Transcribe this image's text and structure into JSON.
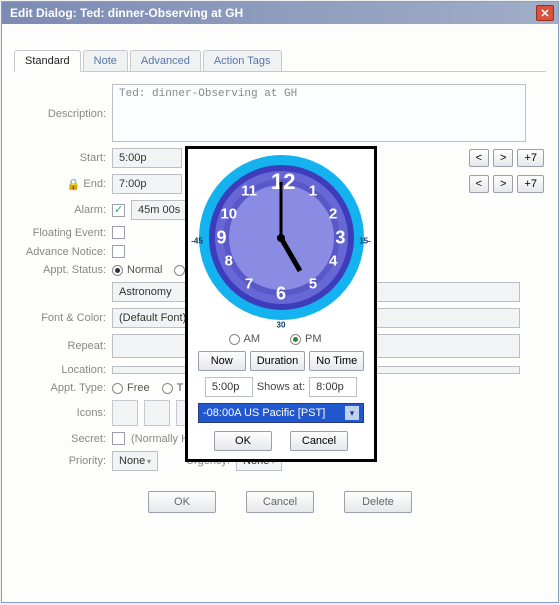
{
  "window": {
    "title": "Edit Dialog:  Ted:  dinner-Observing at GH"
  },
  "tabs": {
    "standard": "Standard",
    "note": "Note",
    "advanced": "Advanced",
    "action_tags": "Action Tags"
  },
  "labels": {
    "description": "Description:",
    "start": "Start:",
    "end": "End:",
    "alarm": "Alarm:",
    "floating_event": "Floating Event:",
    "advance_notice": "Advance Notice:",
    "appt_status": "Appt. Status:",
    "font_color": "Font & Color:",
    "repeat": "Repeat:",
    "location": "Location:",
    "appt_type": "Appt. Type:",
    "icons": "Icons:",
    "secret": "Secret:",
    "priority": "Priority:",
    "urgency": "Urgency:"
  },
  "values": {
    "description": "Ted: dinner-Observing at GH",
    "start": "5:00p",
    "end": "7:00p",
    "alarm": "45m 00s",
    "status_normal": "Normal",
    "category": "Astronomy",
    "font_color": "(Default Font)",
    "repeat": "",
    "location": "",
    "type_free": "Free",
    "type_t": "T",
    "secret": "(Normally Hidden)",
    "priority": "None",
    "urgency": "None"
  },
  "steppers": {
    "prev": "<",
    "next": ">",
    "plus7": "+7"
  },
  "buttons": {
    "ok": "OK",
    "cancel": "Cancel",
    "delete": "Delete"
  },
  "popup": {
    "clock_numbers": {
      "n12": "12",
      "n1": "1",
      "n2": "2",
      "n3": "3",
      "n4": "4",
      "n5": "5",
      "n6": "6",
      "n7": "7",
      "n8": "8",
      "n9": "9",
      "n10": "10",
      "n11": "11"
    },
    "outer_minutes": {
      "m30": "30",
      "m45": "-45",
      "m15": "15-"
    },
    "am": "AM",
    "pm": "PM",
    "now": "Now",
    "duration": "Duration",
    "no_time": "No Time",
    "time_value": "5:00p",
    "shows_at": "Shows at:",
    "shows_value": "8:00p",
    "tz": "-08:00A US Pacific [PST]",
    "ok": "OK",
    "cancel": "Cancel"
  }
}
